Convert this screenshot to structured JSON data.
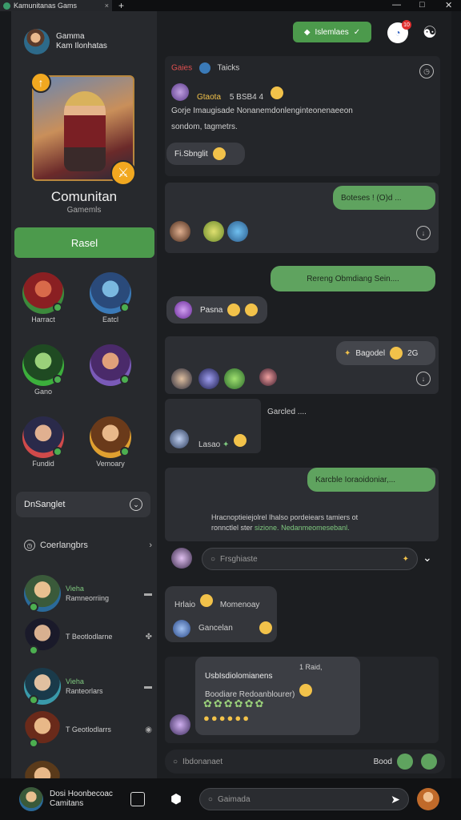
{
  "window": {
    "tab_title": "Kamunitanas Gams",
    "tab_close": "×",
    "new_tab": "+",
    "minimize": "—",
    "maximize": "□",
    "close": "✕"
  },
  "profile": {
    "name": "Gamma",
    "subtitle": "Kam Ilonhatas"
  },
  "hero": {
    "title": "Comunitan",
    "subtitle": "Gamemls",
    "button": "Rasel"
  },
  "grid_members": [
    {
      "label": "Harract"
    },
    {
      "label": "Eatcl"
    },
    {
      "label": "Gano"
    },
    {
      "label": ""
    },
    {
      "label": "Fundid"
    },
    {
      "label": "Vemoary"
    }
  ],
  "dropdown": {
    "label": "DnSanglet"
  },
  "categories": {
    "label": "Coerlangbrs"
  },
  "friends": [
    {
      "name": "Vieha",
      "status": "Ramneorriing"
    },
    {
      "name": "",
      "status": "T Beotlodlarne"
    },
    {
      "name": "Vieha",
      "status": "Ranteorlars"
    },
    {
      "name": "",
      "status": "T Geotlodlarrs"
    }
  ],
  "topbar": {
    "pill": "Islemlaes",
    "notif_count": "10"
  },
  "feed": {
    "header": {
      "channel": "Gaies",
      "tag": "Taicks"
    },
    "post1": {
      "user": "Gtaota",
      "meta": "5 BSB4 4",
      "text_line1": "Gorje Imaugisade Nonanemdonlenginteonenaeeon",
      "text_line2": "sondom, tagmetrs.",
      "reply": "Fi.Sbnglit"
    },
    "post2": {
      "bubble": "Boteses ! (O)d ..."
    },
    "post3": {
      "bubble": "Rereng Obmdiang Sein...."
    },
    "post4": {
      "label": "Pasna"
    },
    "post5": {
      "bubble": "Bagodel",
      "count": "2G"
    },
    "post6": {
      "label": "Garcled ....",
      "user": "Lasao"
    },
    "post7": {
      "bubble": "Karcble Ioraoidoniar,...",
      "line1": "Hracnoptieiejolrel Ihalso pordeiears tamiers ot",
      "line2": "ronnctlel  ster",
      "line2_green": "sizione.",
      "line2_rest": "Nedanmeomesebanl."
    },
    "reply_input": {
      "placeholder": "Frsghiaste"
    },
    "post8": {
      "bubble1": "Hrlaio",
      "bubble1_b": "Momenoay",
      "bubble2": "Gancelan"
    },
    "post9": {
      "meta": "1 Raid,",
      "title": "UsbIsdiolomianens",
      "line": "Boodiare Redoanblourer)"
    },
    "chat_input": {
      "placeholder": "Ibdonanaet",
      "send": "Bood"
    }
  },
  "bottom": {
    "name": "Dosi Hoonbecoac",
    "sub": "Camitans",
    "search_placeholder": "Gaimada"
  },
  "colors": {
    "accent": "#4c9a4c",
    "gold": "#f1a820",
    "panel": "#27292d"
  }
}
